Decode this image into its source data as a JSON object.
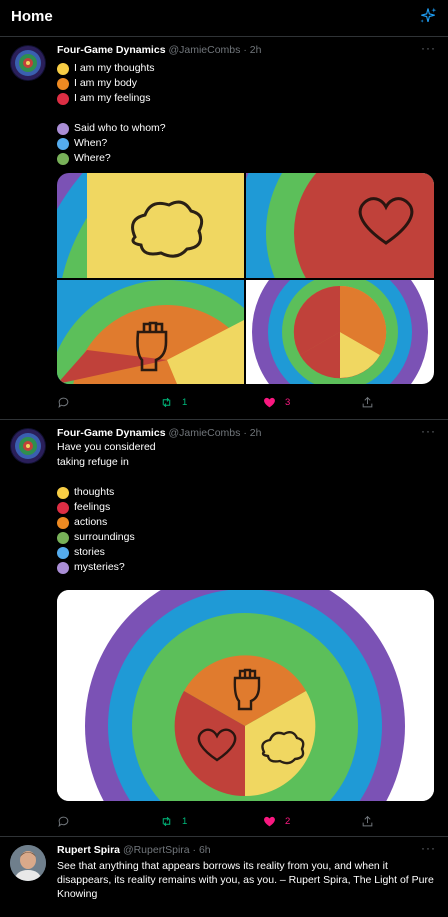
{
  "header": {
    "title": "Home",
    "sparkle_icon": "sparkle-icon"
  },
  "tweets": [
    {
      "name": "Four-Game Dynamics",
      "handle": "@JamieCombs",
      "time": "· 2h",
      "lines": [
        {
          "text": "I am my thoughts",
          "color": "#f7cd45"
        },
        {
          "text": "I am my body",
          "color": "#ee8a22"
        },
        {
          "text": "I am my feelings",
          "color": "#dd2e44"
        },
        {
          "text": "Said who to whom?",
          "color": "#aa8ed6"
        },
        {
          "text": "When?",
          "color": "#55acee"
        },
        {
          "text": "Where?",
          "color": "#78b159"
        }
      ],
      "stats": {
        "replies": "",
        "retweets": "1",
        "likes": "3"
      }
    },
    {
      "name": "Four-Game Dynamics",
      "handle": "@JamieCombs",
      "time": "· 2h",
      "intro1": "Have you considered",
      "intro2": "taking refuge in",
      "lines": [
        {
          "text": "thoughts",
          "color": "#f7cd45"
        },
        {
          "text": "feelings",
          "color": "#dd2e44"
        },
        {
          "text": "actions",
          "color": "#ee8a22"
        },
        {
          "text": "surroundings",
          "color": "#78b159"
        },
        {
          "text": "stories",
          "color": "#55acee"
        },
        {
          "text": "mysteries?",
          "color": "#aa8ed6"
        }
      ],
      "stats": {
        "replies": "",
        "retweets": "1",
        "likes": "2"
      }
    },
    {
      "name": "Rupert Spira",
      "handle": "@RupertSpira",
      "time": "· 6h",
      "text": "See that anything that appears borrows its reality from you, and when it disappears, its reality remains with you, as you. – Rupert Spira, The Light of Pure Knowing"
    }
  ],
  "colors": {
    "accent": "#1d9bf0",
    "retweet": "#00ba7c",
    "like": "#f91880",
    "muted": "#71767b",
    "purple": "#7b52b5",
    "blue": "#1f9ad6",
    "green": "#5cbf5a",
    "orange": "#e07b2e",
    "red": "#c0413a",
    "yellow": "#f0d761"
  }
}
